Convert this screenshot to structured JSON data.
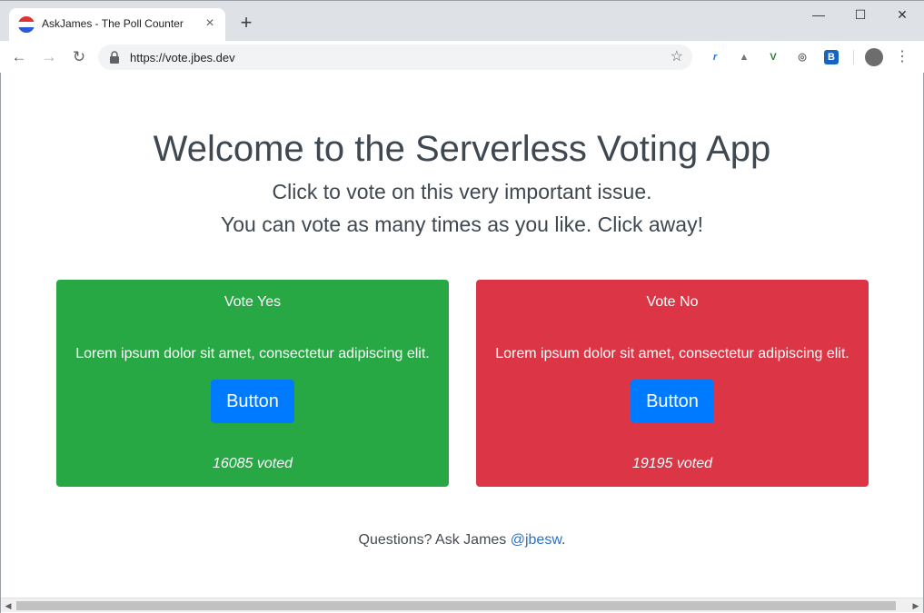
{
  "browser": {
    "tab_title": "AskJames - The Poll Counter",
    "url": "https://vote.jbes.dev",
    "icons": {
      "favicon": "vote-badge-icon",
      "tab_close": "close-icon",
      "new_tab": "plus-icon",
      "back": "arrow-left-icon",
      "forward": "arrow-right-icon",
      "reload": "reload-icon",
      "lock": "lock-icon",
      "bookmark": "star-icon",
      "menu": "kebab-menu-icon"
    }
  },
  "page": {
    "title": "Welcome to the Serverless Voting App",
    "subtitle_1": "Click to vote on this very important issue.",
    "subtitle_2": "You can vote as many times as you like. Click away!",
    "cards": [
      {
        "title": "Vote Yes",
        "text": "Lorem ipsum dolor sit amet, consectetur adipiscing elit.",
        "button": "Button",
        "count": "16085 voted",
        "color": "#28a745"
      },
      {
        "title": "Vote No",
        "text": "Lorem ipsum dolor sit amet, consectetur adipiscing elit.",
        "button": "Button",
        "count": "19195 voted",
        "color": "#dc3545"
      }
    ],
    "footer": {
      "text": "Questions? Ask James ",
      "link": "@jbesw",
      "suffix": "."
    },
    "colors": {
      "button": "#007bff",
      "link": "#2c70c9"
    }
  }
}
